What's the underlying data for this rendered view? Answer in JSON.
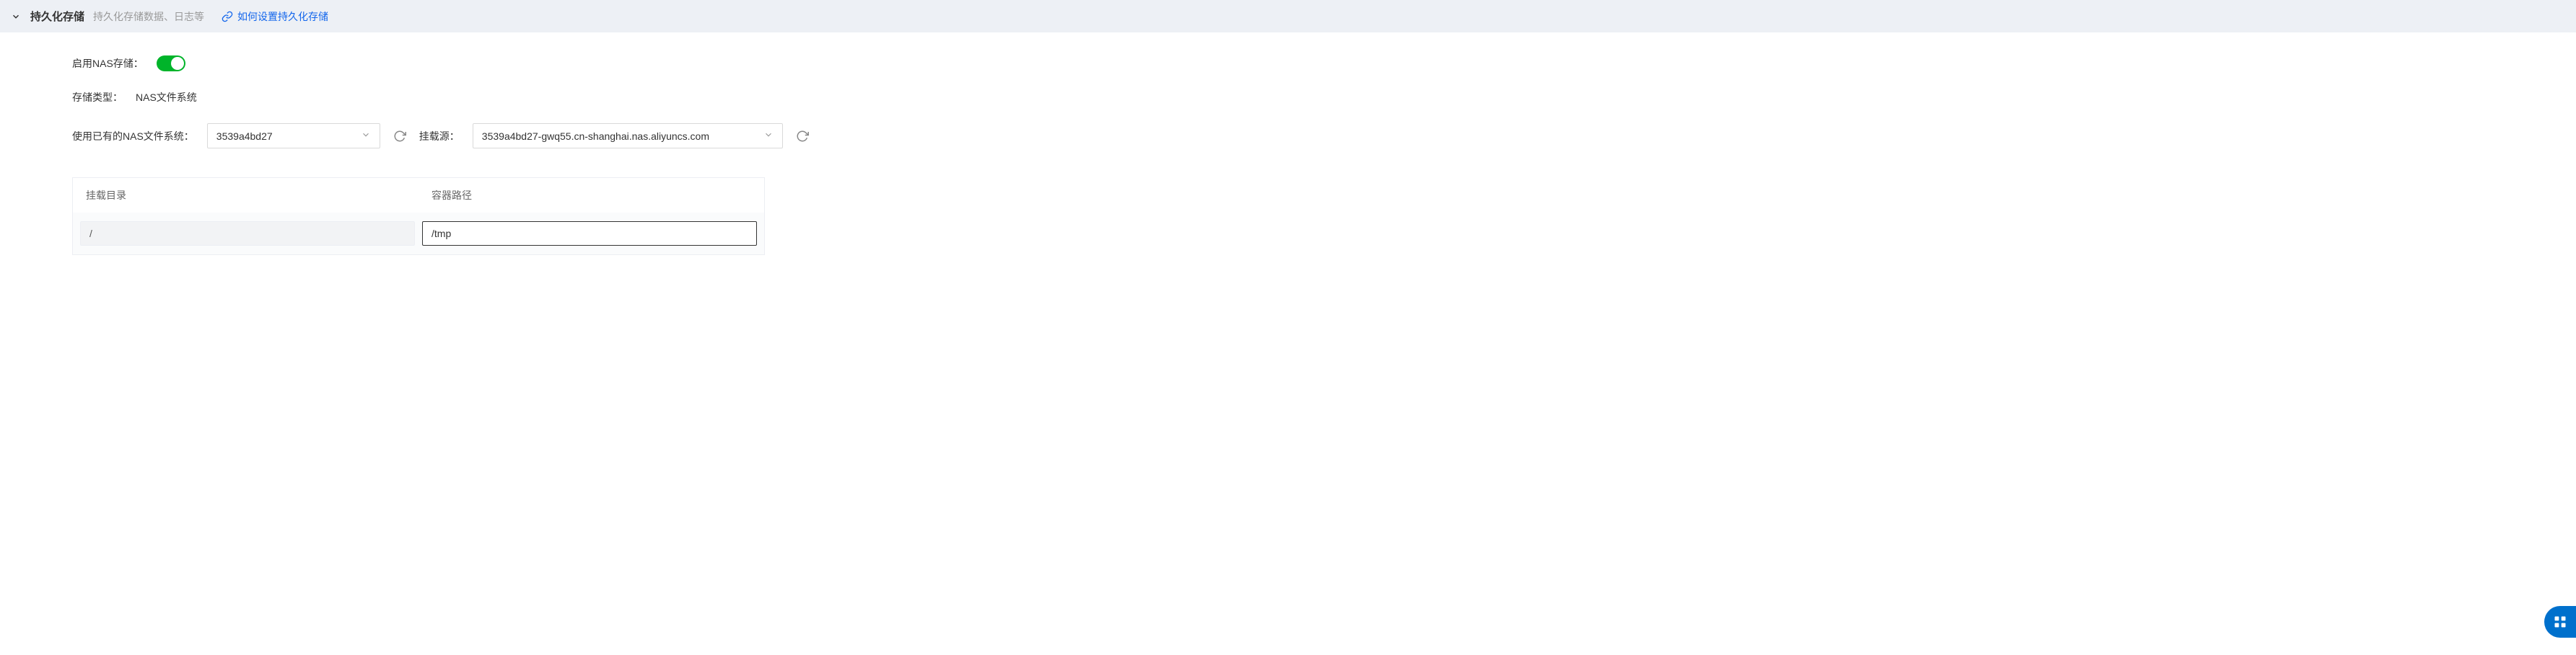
{
  "header": {
    "title": "持久化存储",
    "subtitle": "持久化存储数据、日志等",
    "help_link_text": "如何设置持久化存储"
  },
  "form": {
    "enable_nas_label": "启用NAS存储：",
    "storage_type_label": "存储类型：",
    "storage_type_value": "NAS文件系统",
    "existing_nas_label": "使用已有的NAS文件系统：",
    "existing_nas_value": "3539a4bd27",
    "mount_source_label": "挂载源：",
    "mount_source_value": "3539a4bd27-gwq55.cn-shanghai.nas.aliyuncs.com"
  },
  "table": {
    "headers": {
      "mount_dir": "挂载目录",
      "container_path": "容器路径"
    },
    "row": {
      "mount_dir_value": "/",
      "container_path_value": "/tmp"
    }
  }
}
